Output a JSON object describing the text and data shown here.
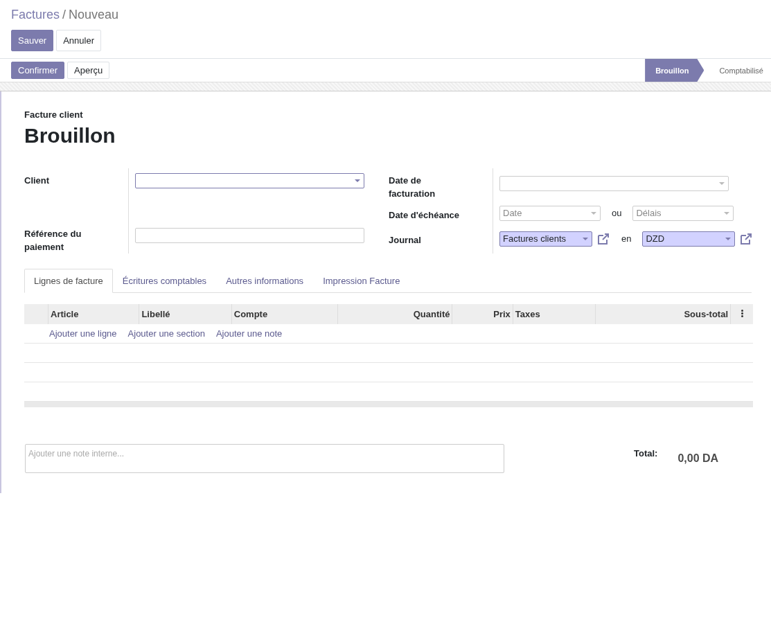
{
  "breadcrumb": {
    "parent": "Factures",
    "separator": "/",
    "current": "Nouveau"
  },
  "buttons": [
    {
      "label": "Sauver",
      "primary": true
    },
    {
      "label": "Annuler",
      "primary": false
    }
  ],
  "actions": [
    {
      "label": "Confirmer",
      "primary": true
    },
    {
      "label": "Aperçu",
      "primary": false
    }
  ],
  "statuses": [
    {
      "label": "Brouillon",
      "selected": true
    },
    {
      "label": "Comptabilisé",
      "selected": false
    }
  ],
  "form": {
    "subtitle": "Facture client",
    "title": "Brouillon",
    "left": [
      {
        "label": "Client",
        "fields": [
          {
            "kind": "select",
            "focused": true,
            "required": false
          }
        ]
      },
      {
        "label": "Référence du paiement",
        "fields": [
          {
            "kind": "input",
            "focused": false,
            "required": false
          }
        ]
      }
    ],
    "right": [
      {
        "label": "Date de facturation",
        "fields": [
          {
            "kind": "select",
            "focused": false,
            "required": false
          }
        ]
      },
      {
        "label": "Date d'échéance",
        "fields": [
          {
            "kind": "select",
            "placeholder": "Date",
            "focused": false,
            "required": false
          },
          {
            "kind": "text",
            "text": "ou"
          },
          {
            "kind": "select",
            "placeholder": "Délais",
            "focused": false,
            "required": false
          }
        ]
      },
      {
        "label": "Journal",
        "fields": [
          {
            "kind": "select",
            "value": "Factures clients",
            "focused": false,
            "required": true,
            "link": true
          },
          {
            "kind": "text",
            "text": "en"
          },
          {
            "kind": "select",
            "value": "DZD",
            "focused": false,
            "required": true,
            "link": true
          }
        ]
      }
    ]
  },
  "tabs": [
    {
      "label": "Lignes de facture",
      "selected": true
    },
    {
      "label": "Écritures comptables",
      "selected": false
    },
    {
      "label": "Autres informations",
      "selected": false
    },
    {
      "label": "Impression Facture",
      "selected": false
    }
  ],
  "table": {
    "columns": [
      {
        "label": "Article",
        "kind": "text"
      },
      {
        "label": "Libellé",
        "kind": "text"
      },
      {
        "label": "Compte",
        "kind": "text"
      },
      {
        "label": "Quantité",
        "kind": "number"
      },
      {
        "label": "Prix",
        "kind": "number"
      },
      {
        "label": "Taxes",
        "kind": "text"
      },
      {
        "label": "Sous-total",
        "kind": "number"
      }
    ],
    "add_links": [
      "Ajouter une ligne",
      "Ajouter une section",
      "Ajouter une note"
    ]
  },
  "note": {
    "placeholder": "Ajouter une note interne..."
  },
  "total": {
    "label": "Total:",
    "value": "0,00 DA"
  }
}
